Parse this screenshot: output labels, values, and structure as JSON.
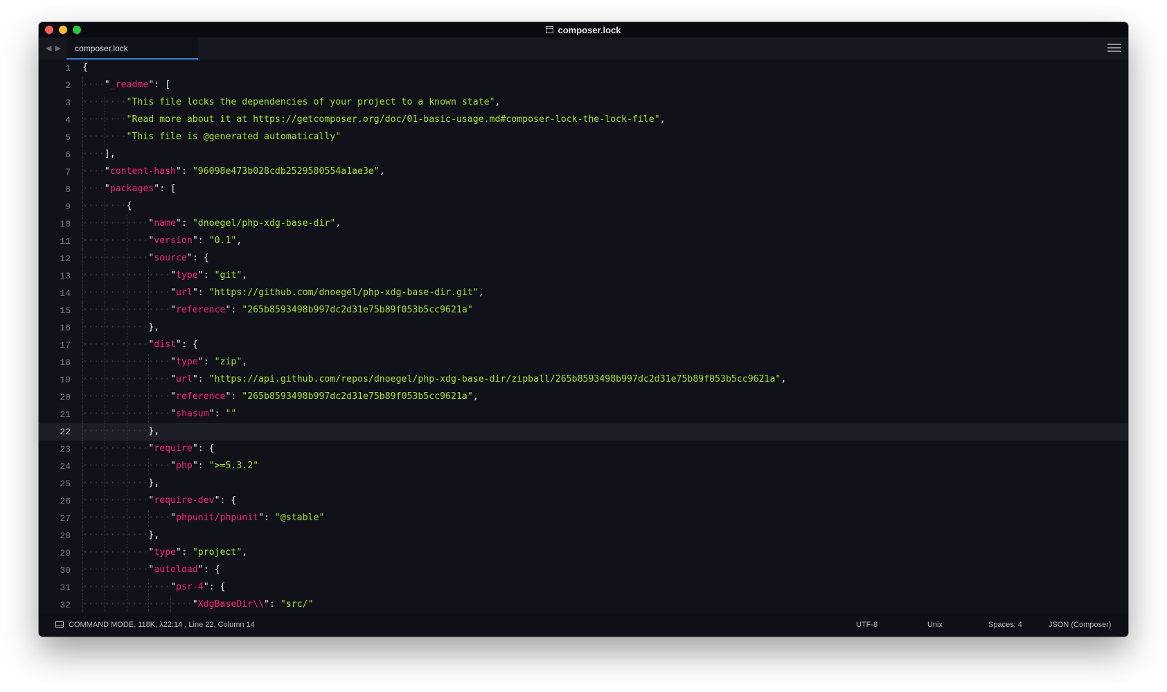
{
  "window": {
    "title": "composer.lock"
  },
  "tab": {
    "label": "composer.lock"
  },
  "editor": {
    "current_line": 22,
    "lines": [
      [
        [
          "p",
          "{"
        ]
      ],
      [
        [
          "d",
          "····"
        ],
        [
          "p",
          "\""
        ],
        [
          "k",
          "_readme"
        ],
        [
          "p",
          "\": ["
        ]
      ],
      [
        [
          "d",
          "········"
        ],
        [
          "s",
          "\"This file locks the dependencies of your project to a known state\""
        ],
        [
          "p",
          ","
        ]
      ],
      [
        [
          "d",
          "········"
        ],
        [
          "s",
          "\"Read more about it at https://getcomposer.org/doc/01-basic-usage.md#composer-lock-the-lock-file\""
        ],
        [
          "p",
          ","
        ]
      ],
      [
        [
          "d",
          "········"
        ],
        [
          "s",
          "\"This file is @generated automatically\""
        ]
      ],
      [
        [
          "d",
          "····"
        ],
        [
          "p",
          "],"
        ]
      ],
      [
        [
          "d",
          "····"
        ],
        [
          "p",
          "\""
        ],
        [
          "k",
          "content-hash"
        ],
        [
          "p",
          "\": "
        ],
        [
          "s",
          "\"96098e473b028cdb2529580554a1ae3e\""
        ],
        [
          "p",
          ","
        ]
      ],
      [
        [
          "d",
          "····"
        ],
        [
          "p",
          "\""
        ],
        [
          "k",
          "packages"
        ],
        [
          "p",
          "\": ["
        ]
      ],
      [
        [
          "d",
          "········"
        ],
        [
          "p",
          "{"
        ]
      ],
      [
        [
          "d",
          "············"
        ],
        [
          "p",
          "\""
        ],
        [
          "k",
          "name"
        ],
        [
          "p",
          "\": "
        ],
        [
          "s",
          "\"dnoegel/php-xdg-base-dir\""
        ],
        [
          "p",
          ","
        ]
      ],
      [
        [
          "d",
          "············"
        ],
        [
          "p",
          "\""
        ],
        [
          "k",
          "version"
        ],
        [
          "p",
          "\": "
        ],
        [
          "s",
          "\"0.1\""
        ],
        [
          "p",
          ","
        ]
      ],
      [
        [
          "d",
          "············"
        ],
        [
          "p",
          "\""
        ],
        [
          "k",
          "source"
        ],
        [
          "p",
          "\": {"
        ]
      ],
      [
        [
          "d",
          "················"
        ],
        [
          "p",
          "\""
        ],
        [
          "k",
          "type"
        ],
        [
          "p",
          "\": "
        ],
        [
          "s",
          "\"git\""
        ],
        [
          "p",
          ","
        ]
      ],
      [
        [
          "d",
          "················"
        ],
        [
          "p",
          "\""
        ],
        [
          "k",
          "url"
        ],
        [
          "p",
          "\": "
        ],
        [
          "s",
          "\"https://github.com/dnoegel/php-xdg-base-dir.git\""
        ],
        [
          "p",
          ","
        ]
      ],
      [
        [
          "d",
          "················"
        ],
        [
          "p",
          "\""
        ],
        [
          "k",
          "reference"
        ],
        [
          "p",
          "\": "
        ],
        [
          "s",
          "\"265b8593498b997dc2d31e75b89f053b5cc9621a\""
        ]
      ],
      [
        [
          "d",
          "············"
        ],
        [
          "p",
          "},"
        ]
      ],
      [
        [
          "d",
          "············"
        ],
        [
          "p",
          "\""
        ],
        [
          "k",
          "dist"
        ],
        [
          "p",
          "\": {"
        ]
      ],
      [
        [
          "d",
          "················"
        ],
        [
          "p",
          "\""
        ],
        [
          "k",
          "type"
        ],
        [
          "p",
          "\": "
        ],
        [
          "s",
          "\"zip\""
        ],
        [
          "p",
          ","
        ]
      ],
      [
        [
          "d",
          "················"
        ],
        [
          "p",
          "\""
        ],
        [
          "k",
          "url"
        ],
        [
          "p",
          "\": "
        ],
        [
          "s",
          "\"https://api.github.com/repos/dnoegel/php-xdg-base-dir/zipball/265b8593498b997dc2d31e75b89f053b5cc9621a\""
        ],
        [
          "p",
          ","
        ]
      ],
      [
        [
          "d",
          "················"
        ],
        [
          "p",
          "\""
        ],
        [
          "k",
          "reference"
        ],
        [
          "p",
          "\": "
        ],
        [
          "s",
          "\"265b8593498b997dc2d31e75b89f053b5cc9621a\""
        ],
        [
          "p",
          ","
        ]
      ],
      [
        [
          "d",
          "················"
        ],
        [
          "p",
          "\""
        ],
        [
          "k",
          "shasum"
        ],
        [
          "p",
          "\": "
        ],
        [
          "s",
          "\"\""
        ]
      ],
      [
        [
          "d",
          "············"
        ],
        [
          "p",
          "},"
        ]
      ],
      [
        [
          "d",
          "············"
        ],
        [
          "p",
          "\""
        ],
        [
          "k",
          "require"
        ],
        [
          "p",
          "\": {"
        ]
      ],
      [
        [
          "d",
          "················"
        ],
        [
          "p",
          "\""
        ],
        [
          "k",
          "php"
        ],
        [
          "p",
          "\": "
        ],
        [
          "s",
          "\">=5.3.2\""
        ]
      ],
      [
        [
          "d",
          "············"
        ],
        [
          "p",
          "},"
        ]
      ],
      [
        [
          "d",
          "············"
        ],
        [
          "p",
          "\""
        ],
        [
          "k",
          "require-dev"
        ],
        [
          "p",
          "\": {"
        ]
      ],
      [
        [
          "d",
          "················"
        ],
        [
          "p",
          "\""
        ],
        [
          "k",
          "phpunit/phpunit"
        ],
        [
          "p",
          "\": "
        ],
        [
          "s",
          "\"@stable\""
        ]
      ],
      [
        [
          "d",
          "············"
        ],
        [
          "p",
          "},"
        ]
      ],
      [
        [
          "d",
          "············"
        ],
        [
          "p",
          "\""
        ],
        [
          "k",
          "type"
        ],
        [
          "p",
          "\": "
        ],
        [
          "s",
          "\"project\""
        ],
        [
          "p",
          ","
        ]
      ],
      [
        [
          "d",
          "············"
        ],
        [
          "p",
          "\""
        ],
        [
          "k",
          "autoload"
        ],
        [
          "p",
          "\": {"
        ]
      ],
      [
        [
          "d",
          "················"
        ],
        [
          "p",
          "\""
        ],
        [
          "k",
          "psr-4"
        ],
        [
          "p",
          "\": {"
        ]
      ],
      [
        [
          "d",
          "····················"
        ],
        [
          "p",
          "\""
        ],
        [
          "k",
          "XdgBaseDir\\\\"
        ],
        [
          "p",
          "\": "
        ],
        [
          "s",
          "\"src/\""
        ]
      ]
    ]
  },
  "status": {
    "left": "COMMAND MODE, 118K, λ22:14   , Line 22, Column 14",
    "encoding": "UTF-8",
    "line_endings": "Unix",
    "indentation": "Spaces: 4",
    "syntax": "JSON (Composer)"
  }
}
